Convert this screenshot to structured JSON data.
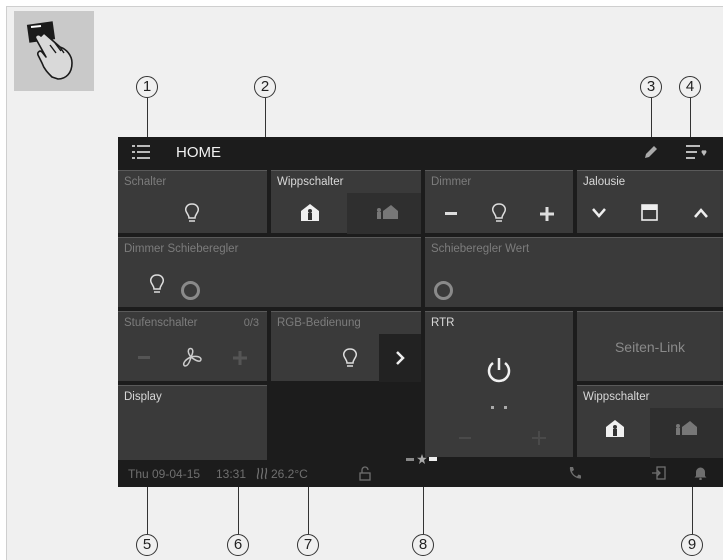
{
  "callouts": [
    "1",
    "2",
    "3",
    "4",
    "5",
    "6",
    "7",
    "8",
    "9"
  ],
  "header": {
    "title": "HOME",
    "menu_icon": "list-icon",
    "edit_icon": "pencil-icon",
    "favorites_icon": "list-heart-icon"
  },
  "tiles": {
    "schalter": {
      "label": "Schalter"
    },
    "wippschalter": {
      "label": "Wippschalter"
    },
    "dimmer": {
      "label": "Dimmer"
    },
    "jalousie": {
      "label": "Jalousie"
    },
    "dimmer_schieberegler": {
      "label": "Dimmer Schieberegler"
    },
    "schieberegler_wert": {
      "label": "Schieberegler Wert"
    },
    "stufenschalter": {
      "label": "Stufenschalter",
      "count": "0/3"
    },
    "rgb": {
      "label": "RGB-Bedienung"
    },
    "rtr": {
      "label": "RTR"
    },
    "seiten_link": {
      "label": "Seiten-Link"
    },
    "display": {
      "label": "Display"
    },
    "wippschalter2": {
      "label": "Wippschalter"
    }
  },
  "status": {
    "date": "Thu 09-04-15",
    "time": "13:31",
    "temperature": "26.2°C"
  },
  "colors": {
    "screen_bg": "#1c1c1c",
    "tile_bg": "#3a3a3a",
    "text_active": "#f2f2f2",
    "text_dim": "#7c7c7c"
  }
}
